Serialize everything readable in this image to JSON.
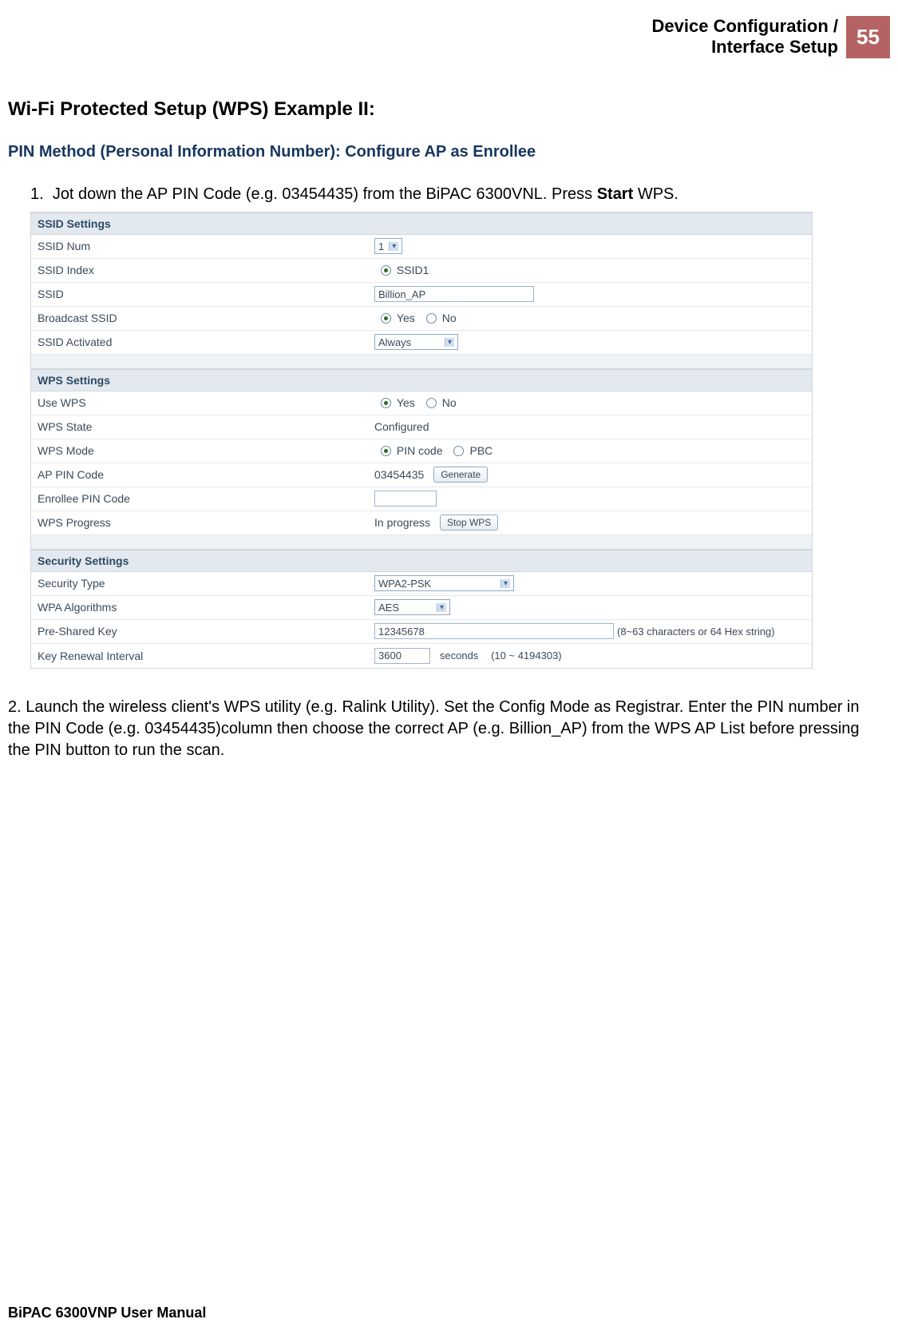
{
  "header": {
    "breadcrumb_line1": "Device Configuration /",
    "breadcrumb_line2": "Interface Setup",
    "page_number": "55"
  },
  "titles": {
    "main": "Wi-Fi Protected Setup (WPS) Example II:",
    "sub": "PIN Method (Personal Information Number): Configure AP as Enrollee"
  },
  "step1": {
    "num": "1.",
    "pre": "Jot down the AP PIN Code (e.g. 03454435) from the BiPAC 6300VNL. Press ",
    "bold": "Start",
    "post": " WPS."
  },
  "config": {
    "ssid_section": "SSID Settings",
    "wps_section": "WPS Settings",
    "sec_section": "Security Settings",
    "rows": {
      "ssid_num": {
        "label": "SSID Num",
        "value": "1"
      },
      "ssid_index": {
        "label": "SSID Index",
        "option1": "SSID1"
      },
      "ssid": {
        "label": "SSID",
        "value": "Billion_AP"
      },
      "broadcast_ssid": {
        "label": "Broadcast SSID",
        "yes": "Yes",
        "no": "No"
      },
      "ssid_activated": {
        "label": "SSID Activated",
        "value": "Always"
      },
      "use_wps": {
        "label": "Use WPS",
        "yes": "Yes",
        "no": "No"
      },
      "wps_state": {
        "label": "WPS State",
        "value": "Configured"
      },
      "wps_mode": {
        "label": "WPS Mode",
        "pin": "PIN code",
        "pbc": "PBC"
      },
      "ap_pin": {
        "label": "AP PIN Code",
        "value": "03454435",
        "btn": "Generate"
      },
      "enrollee_pin": {
        "label": "Enrollee PIN Code",
        "value": ""
      },
      "wps_progress": {
        "label": "WPS Progress",
        "value": "In progress",
        "btn": "Stop WPS"
      },
      "sec_type": {
        "label": "Security Type",
        "value": "WPA2-PSK"
      },
      "wpa_alg": {
        "label": "WPA Algorithms",
        "value": "AES"
      },
      "psk": {
        "label": "Pre-Shared Key",
        "value": "12345678",
        "note": "(8~63 characters or 64 Hex string)"
      },
      "key_renew": {
        "label": "Key Renewal Interval",
        "value": "3600",
        "unit": "seconds",
        "range": "(10 ~ 4194303)"
      }
    }
  },
  "step2": "2. Launch the wireless client's WPS utility (e.g. Ralink Utility). Set the Config Mode as Registrar. Enter the PIN number in the PIN Code (e.g. 03454435)column then choose the correct AP (e.g. Billion_AP) from the WPS AP List before pressing the PIN button to run the scan.",
  "footer": "BiPAC 6300VNP User Manual"
}
